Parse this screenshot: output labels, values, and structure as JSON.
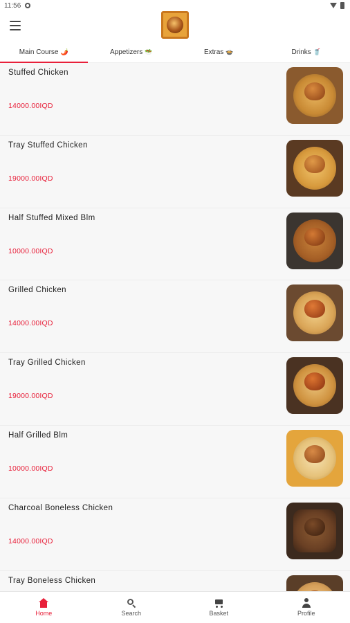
{
  "status_bar": {
    "time": "11:56",
    "location_icon": "location-dot-icon",
    "wifi_icon": "wifi-icon",
    "battery_icon": "battery-icon"
  },
  "header": {
    "menu_icon": "menu-icon",
    "logo_icon": "restaurant-logo"
  },
  "tabs": [
    {
      "label": "Main Course",
      "emoji": "🌶️",
      "active": true
    },
    {
      "label": "Appetizers",
      "emoji": "🥗",
      "active": false
    },
    {
      "label": "Extras",
      "emoji": "🍲",
      "active": false
    },
    {
      "label": "Drinks",
      "emoji": "🥤",
      "active": false
    }
  ],
  "items": [
    {
      "name": "Stuffed Chicken",
      "price": "14000.00IQD"
    },
    {
      "name": "Tray Stuffed Chicken",
      "price": "19000.00IQD"
    },
    {
      "name": "Half Stuffed Mixed Blm",
      "price": "10000.00IQD"
    },
    {
      "name": "Grilled Chicken",
      "price": "14000.00IQD"
    },
    {
      "name": "Tray Grilled Chicken",
      "price": "19000.00IQD"
    },
    {
      "name": "Half Grilled Blm",
      "price": "10000.00IQD"
    },
    {
      "name": "Charcoal Boneless Chicken",
      "price": "14000.00IQD"
    },
    {
      "name": "Tray Boneless Chicken",
      "price": ""
    }
  ],
  "colors": {
    "accent": "#e8203a",
    "text": "#222222",
    "list_bg": "#f7f7f7"
  },
  "bottom_nav": [
    {
      "label": "Home",
      "icon": "home-icon",
      "active": true
    },
    {
      "label": "Search",
      "icon": "search-icon",
      "active": false
    },
    {
      "label": "Basket",
      "icon": "cart-icon",
      "active": false
    },
    {
      "label": "Profile",
      "icon": "profile-icon",
      "active": false
    }
  ]
}
